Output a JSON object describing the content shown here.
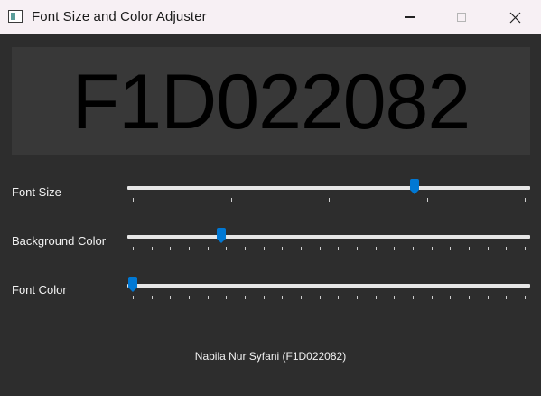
{
  "window": {
    "title": "Font Size and Color Adjuster",
    "controls": {
      "minimize": "minimize-icon",
      "maximize": "maximize-icon",
      "close": "close-icon"
    }
  },
  "display": {
    "text": "F1D022082",
    "background_color": "#383838",
    "text_color": "#000000"
  },
  "controls": [
    {
      "id": "size",
      "label": "Font Size",
      "value_fraction": 0.72,
      "tick_count": 5
    },
    {
      "id": "bg",
      "label": "Background Color",
      "value_fraction": 0.225,
      "tick_count": 22
    },
    {
      "id": "color",
      "label": "Font Color",
      "value_fraction": 0.0,
      "tick_count": 22
    }
  ],
  "footer": {
    "text": "Nabila Nur Syfani (F1D022082)"
  },
  "colors": {
    "accent": "#0078d4",
    "window_bg": "#2d2d2d",
    "titlebar_bg": "#f7f0f4",
    "groove": "#e6e6e6"
  }
}
